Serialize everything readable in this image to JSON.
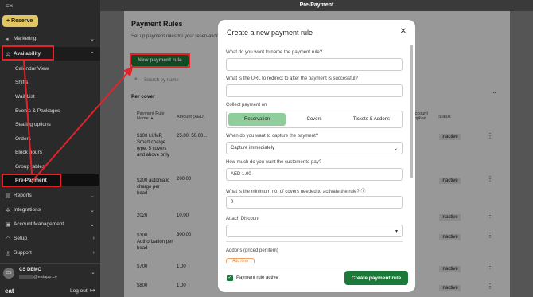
{
  "sidebar": {
    "collapse_icon": "≡×",
    "reserve_label": "Reserve",
    "items": [
      {
        "label": "Marketing"
      },
      {
        "label": "Availability"
      },
      {
        "label": "Reports"
      },
      {
        "label": "Integrations"
      },
      {
        "label": "Account Management"
      },
      {
        "label": "Setup"
      },
      {
        "label": "Support"
      }
    ],
    "sub_items": [
      "Calendar View",
      "Shifts",
      "Wait List",
      "Events & Packages",
      "Seating options",
      "Orders",
      "Block hours",
      "Group tables",
      "Pre-Payment"
    ],
    "user": {
      "initials": "CS",
      "name": "CS DEMO",
      "email": "@eatapp.co"
    },
    "logo": "eat",
    "logout": "Log out"
  },
  "topbar": {
    "title": "Pre-Payment"
  },
  "page": {
    "title": "Payment Rules",
    "subtitle": "Set up payment rules for your reservations",
    "new_rule_button": "New payment rule",
    "search_placeholder": "Search by name",
    "section_title": "Per cover",
    "columns": [
      "Payment Rule Name ▲",
      "Amount (AED)",
      "Account applied",
      "Status"
    ],
    "rows": [
      {
        "name": "$100 LUMP, Smart charge type, 5 covers and above only",
        "amount": "25.00, 50.00...",
        "status": "Inactive"
      },
      {
        "name": "$200 automatic charge per head",
        "amount": "200.00",
        "status": "Inactive"
      },
      {
        "name": "2026",
        "amount": "10.00",
        "status": "Inactive"
      },
      {
        "name": "$300 Authorization per head",
        "amount": "300.00",
        "status": "Inactive"
      },
      {
        "name": "$700",
        "amount": "1.00",
        "status": "Inactive"
      },
      {
        "name": "$800",
        "amount": "1.00",
        "status": "Inactive"
      }
    ]
  },
  "modal": {
    "title": "Create a new payment rule",
    "q_name": "What do you want to name the payment rule?",
    "q_url": "What is the URL to redirect to after the payment is successful?",
    "collect_label": "Collect payment on",
    "collect_options": [
      "Reservation",
      "Covers",
      "Tickets & Addons"
    ],
    "q_when": "When do you want to capture the payment?",
    "when_value": "Capture immediately",
    "q_how_much": "How much do you want the customer to pay?",
    "currency": "AED",
    "amount_value": "1.00",
    "q_min_covers": "What is the minimum no. of covers needed to activate the rule?",
    "min_covers_value": "0",
    "discount_label": "Attach Discount",
    "addons_label": "Addons (priced per item)",
    "add_item": "Add item",
    "active_label": "Payment rule active",
    "create_button": "Create payment rule"
  },
  "colors": {
    "accent": "#1b7a3a",
    "highlight": "#e2232a",
    "reserve": "#f6d86a"
  }
}
